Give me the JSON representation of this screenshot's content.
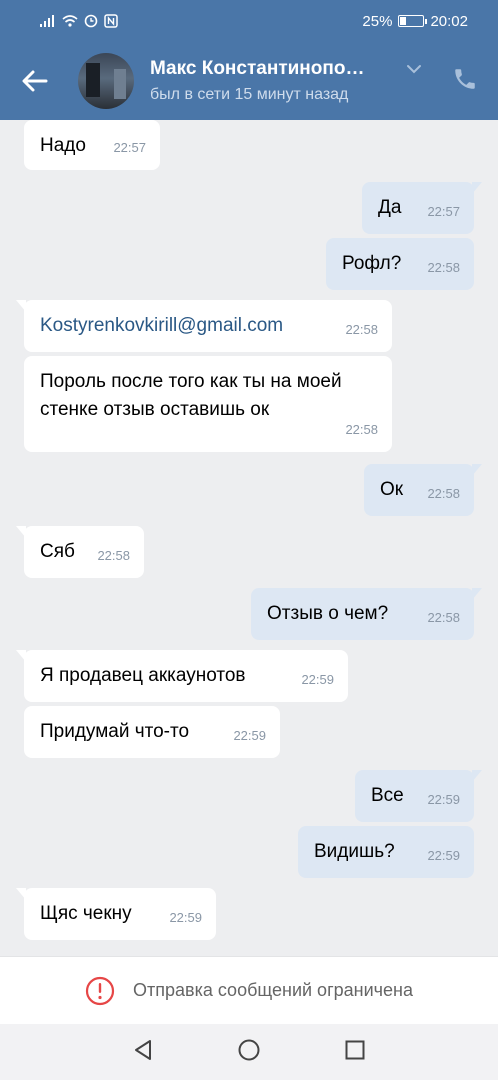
{
  "status_bar": {
    "battery": "25%",
    "time": "20:02",
    "battery_level_pct": 25
  },
  "header": {
    "contact_name": "Макс Константинопо…",
    "contact_status": "был в сети 15 минут назад"
  },
  "messages": [
    {
      "dir": "in",
      "text": "Надо",
      "time": "22:57"
    },
    {
      "dir": "out",
      "text": "Да",
      "time": "22:57"
    },
    {
      "dir": "out",
      "text": "Рофл?",
      "time": "22:58"
    },
    {
      "dir": "in",
      "text": "Kostyrenkovkirill@gmail.com",
      "time": "22:58"
    },
    {
      "dir": "in",
      "text": "Пороль после того как ты на моей стенке отзыв оставишь ок",
      "time": "22:58"
    },
    {
      "dir": "out",
      "text": "Ок",
      "time": "22:58"
    },
    {
      "dir": "in",
      "text": "Сяб",
      "time": "22:58"
    },
    {
      "dir": "out",
      "text": "Отзыв о чем?",
      "time": "22:58"
    },
    {
      "dir": "in",
      "text": "Я продавец аккаунотов",
      "time": "22:59"
    },
    {
      "dir": "in",
      "text": "Придумай что-то",
      "time": "22:59"
    },
    {
      "dir": "out",
      "text": "Все",
      "time": "22:59"
    },
    {
      "dir": "out",
      "text": "Видишь?",
      "time": "22:59"
    },
    {
      "dir": "in",
      "text": "Щяс чекну",
      "time": "22:59"
    }
  ],
  "restriction": {
    "text": "Отправка сообщений ограничена"
  },
  "colors": {
    "header": "#4a76a8",
    "incoming_bubble": "#ffffff",
    "outgoing_bubble": "#dde7f3",
    "link": "#2a5885",
    "warning": "#e64646"
  },
  "icons": [
    "back-arrow-icon",
    "chevron-down-icon",
    "phone-icon",
    "warning-icon",
    "nav-back-icon",
    "nav-home-icon",
    "nav-recents-icon"
  ]
}
